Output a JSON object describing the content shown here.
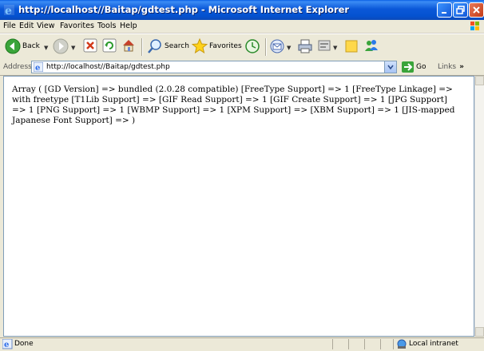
{
  "window": {
    "title": "http://localhost//Baitap/gdtest.php - Microsoft Internet Explorer"
  },
  "menu": {
    "items": [
      "File",
      "Edit",
      "View",
      "Favorites",
      "Tools",
      "Help"
    ]
  },
  "toolbar": {
    "back_label": "Back",
    "search_label": "Search",
    "favorites_label": "Favorites"
  },
  "address": {
    "label": "Address",
    "url": "http://localhost//Baitap/gdtest.php",
    "go_label": "Go",
    "links_label": "Links"
  },
  "content": {
    "text": "Array ( [GD Version] => bundled (2.0.28 compatible) [FreeType Support] => 1 [FreeType Linkage] => with freetype [T1Lib Support] => [GIF Read Support] => 1 [GIF Create Support] => 1 [JPG Support] => 1 [PNG Support] => 1 [WBMP Support] => 1 [XPM Support] => [XBM Support] => 1 [JIS-mapped Japanese Font Support] => )"
  },
  "status": {
    "text": "Done",
    "zone": "Local intranet"
  },
  "colors": {
    "titlebar": "#0452d0",
    "chrome": "#ece9d8",
    "close_button": "#c33a15"
  }
}
